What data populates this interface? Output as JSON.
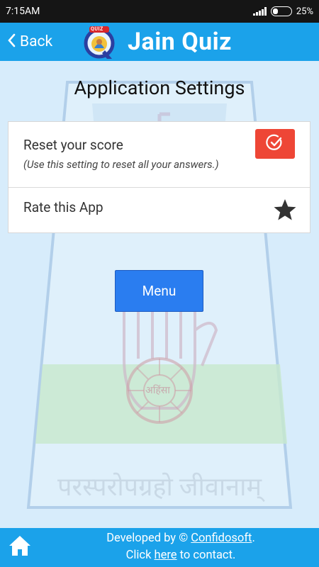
{
  "status_bar": {
    "time": "7:15AM",
    "battery": "25%"
  },
  "app_bar": {
    "back_label": "Back",
    "title": "Jain Quiz",
    "logo_text": "QUIZ"
  },
  "watermark": {
    "center_text": "अहिंसा",
    "bottom_text": "परस्परोपग्रहो जीवानाम्"
  },
  "page": {
    "title": "Application Settings"
  },
  "settings": {
    "reset": {
      "label": "Reset your score",
      "sublabel": "(Use this setting to reset all your answers.)"
    },
    "rate": {
      "label": "Rate this App"
    }
  },
  "menu_button": {
    "label": "Menu"
  },
  "footer": {
    "developed_by": "Developed by ©",
    "company": "Confidosoft",
    "period": ".",
    "click": "Click",
    "here": "here",
    "to_contact": "to contact."
  },
  "colors": {
    "app_bar": "#1ba2ea",
    "background": "#d7ecfb",
    "reset_button": "#ee4636",
    "menu_button": "#2a7df0"
  }
}
